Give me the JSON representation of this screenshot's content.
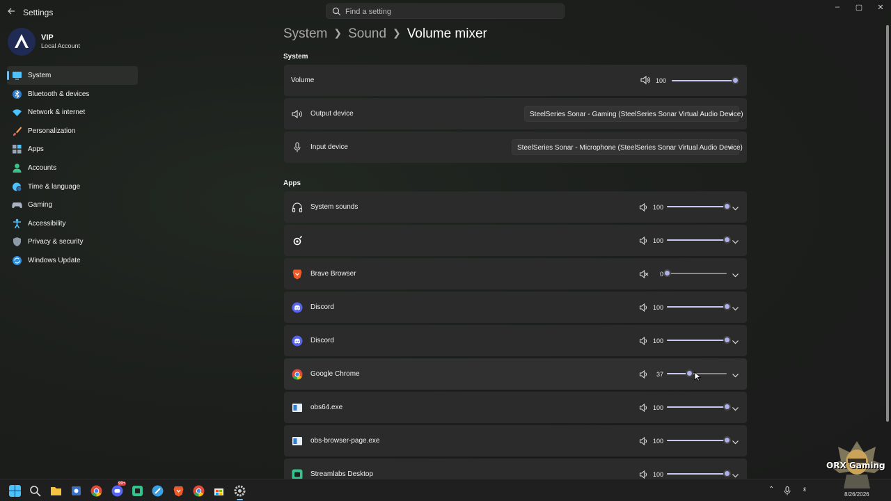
{
  "window": {
    "title": "Settings",
    "controls": {
      "minimize": "–",
      "maximize": "▢",
      "close": "✕"
    }
  },
  "search": {
    "placeholder": "Find a setting"
  },
  "profile": {
    "name": "VIP",
    "account_type": "Local Account"
  },
  "sidebar": {
    "items": [
      {
        "label": "System",
        "icon": "system-icon",
        "active": true
      },
      {
        "label": "Bluetooth & devices",
        "icon": "bluetooth-icon"
      },
      {
        "label": "Network & internet",
        "icon": "wifi-icon"
      },
      {
        "label": "Personalization",
        "icon": "brush-icon"
      },
      {
        "label": "Apps",
        "icon": "apps-icon"
      },
      {
        "label": "Accounts",
        "icon": "person-icon"
      },
      {
        "label": "Time & language",
        "icon": "globe-clock-icon"
      },
      {
        "label": "Gaming",
        "icon": "controller-icon"
      },
      {
        "label": "Accessibility",
        "icon": "accessibility-icon"
      },
      {
        "label": "Privacy & security",
        "icon": "shield-icon"
      },
      {
        "label": "Windows Update",
        "icon": "update-icon"
      }
    ]
  },
  "breadcrumb": {
    "level1": "System",
    "level2": "Sound",
    "current": "Volume mixer"
  },
  "system_section": {
    "heading": "System",
    "volume": {
      "label": "Volume",
      "value": 100
    },
    "output": {
      "label": "Output device",
      "selected": "SteelSeries Sonar - Gaming (SteelSeries Sonar Virtual Audio Device)"
    },
    "input": {
      "label": "Input device",
      "selected": "SteelSeries Sonar - Microphone (SteelSeries Sonar Virtual Audio Device)"
    }
  },
  "apps_section": {
    "heading": "Apps",
    "apps": [
      {
        "name": "System sounds",
        "icon": "headphones-icon",
        "volume": 100,
        "muted": false
      },
      {
        "name": "",
        "icon": "steelseries-icon",
        "volume": 100,
        "muted": false
      },
      {
        "name": "Brave Browser",
        "icon": "brave-icon",
        "volume": 0,
        "muted": true
      },
      {
        "name": "Discord",
        "icon": "discord-icon",
        "volume": 100,
        "muted": false
      },
      {
        "name": "Discord",
        "icon": "discord-icon",
        "volume": 100,
        "muted": false
      },
      {
        "name": "Google Chrome",
        "icon": "chrome-icon",
        "volume": 37,
        "muted": false
      },
      {
        "name": "obs64.exe",
        "icon": "obs-icon",
        "volume": 100,
        "muted": false
      },
      {
        "name": "obs-browser-page.exe",
        "icon": "obs-icon",
        "volume": 100,
        "muted": false
      },
      {
        "name": "Streamlabs Desktop",
        "icon": "streamlabs-icon",
        "volume": 100,
        "muted": false
      }
    ]
  },
  "taskbar": {
    "date": "8/26/2026",
    "notification_badge": "99+",
    "input_indicator": "ε"
  },
  "watermark": {
    "text": "ORX Gaming"
  },
  "colors": {
    "accent": "#76b9ed",
    "slider": "#c9c8f0",
    "row_bg": "#2a2b2a"
  }
}
